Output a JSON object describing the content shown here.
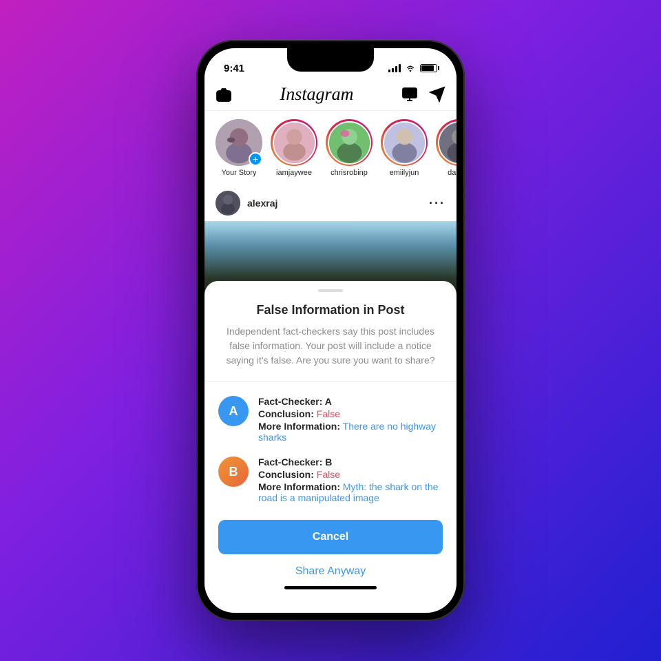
{
  "phone": {
    "status_bar": {
      "time": "9:41"
    },
    "instagram": {
      "title": "Instagram",
      "header_icons": {
        "camera": "📷",
        "igtv": "📺",
        "send": "✈"
      },
      "stories": [
        {
          "id": "your-story",
          "username": "Your Story",
          "avatar_key": "yourStory",
          "has_ring": false,
          "has_add": true
        },
        {
          "id": "a",
          "username": "iamjaywee",
          "avatar_key": "a",
          "has_ring": true,
          "has_add": false
        },
        {
          "id": "b",
          "username": "chrisrobinp",
          "avatar_key": "b",
          "has_ring": true,
          "has_add": false
        },
        {
          "id": "c",
          "username": "emiilyjun",
          "avatar_key": "c",
          "has_ring": true,
          "has_add": false
        },
        {
          "id": "d",
          "username": "dantob",
          "avatar_key": "d",
          "has_ring": true,
          "has_add": false
        }
      ],
      "post": {
        "username": "alexraj",
        "more_options": "···"
      }
    },
    "modal": {
      "title": "False Information in Post",
      "description": "Independent fact-checkers say this post includes false information. Your post will include a notice saying it's false. Are you sure you want to share?",
      "fact_checkers": [
        {
          "id": "A",
          "name": "Fact-Checker: A",
          "conclusion_label": "Conclusion:",
          "conclusion_value": "False",
          "more_info_label": "More Information:",
          "more_info_value": "There are no highway sharks"
        },
        {
          "id": "B",
          "name": "Fact-Checker: B",
          "conclusion_label": "Conclusion:",
          "conclusion_value": "False",
          "more_info_label": "More Information:",
          "more_info_value": "Myth: the shark on the road is a manipulated image"
        }
      ],
      "cancel_button": "Cancel",
      "share_anyway_button": "Share Anyway"
    }
  }
}
